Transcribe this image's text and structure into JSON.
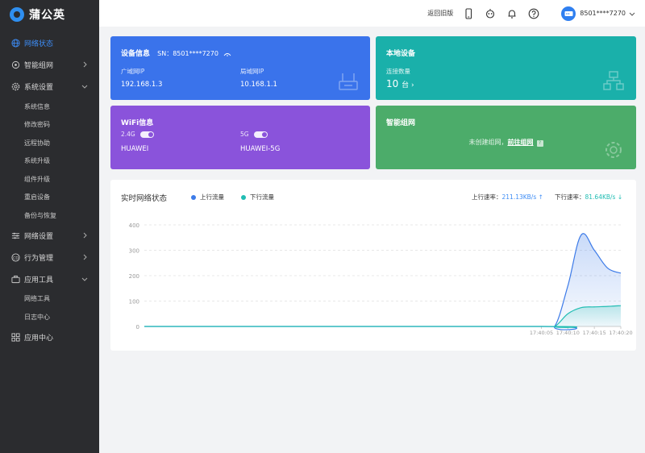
{
  "app": {
    "name": "蒲公英"
  },
  "sidebar": {
    "items": [
      {
        "label": "网络状态",
        "icon": "globe-icon",
        "active": true
      },
      {
        "label": "智能组网",
        "icon": "mesh-icon"
      },
      {
        "label": "系统设置",
        "icon": "gear-icon",
        "expanded": true,
        "children": [
          "系统信息",
          "修改密码",
          "远程协助",
          "系统升级",
          "组件升级",
          "重启设备",
          "备份与恢复"
        ]
      },
      {
        "label": "网络设置",
        "icon": "sliders-icon"
      },
      {
        "label": "行为管理",
        "icon": "behavior-icon"
      },
      {
        "label": "应用工具",
        "icon": "briefcase-icon",
        "expanded": true,
        "children": [
          "网络工具",
          "日志中心"
        ]
      },
      {
        "label": "应用中心",
        "icon": "apps-grid-icon"
      }
    ]
  },
  "header": {
    "back_label": "返回旧版",
    "user": "8501****7270",
    "icons": [
      "phone-icon",
      "robot-icon",
      "bell-icon",
      "help-icon"
    ]
  },
  "cards": {
    "device": {
      "title": "设备信息",
      "sn": "SN：8501****7270",
      "wan_label": "广域网IP",
      "wan_value": "192.168.1.3",
      "lan_label": "局域网IP",
      "lan_value": "10.168.1.1"
    },
    "local": {
      "title": "本地设备",
      "count_label": "连接数量",
      "count_value": "10",
      "count_unit": "台 ›"
    },
    "wifi": {
      "title": "WiFi信息",
      "band_a": "2.4G",
      "band_b": "5G",
      "ssid_a": "HUAWEI",
      "ssid_b": "HUAWEI-5G"
    },
    "mesh": {
      "title": "智能组网",
      "text": "未创建组网，",
      "link": "前往组网"
    }
  },
  "panel": {
    "title": "实时网络状态",
    "up_rate_label": "上行速率：",
    "up_rate_value": "211.13KB/s ↑",
    "down_rate_label": "下行速率：",
    "down_rate_value": "81.64KB/s ↓"
  },
  "colors": {
    "up": "#3d7be8",
    "down": "#21bdb3"
  },
  "chart_data": {
    "type": "area",
    "x_ticks": [
      "17:40:05",
      "17:40:10",
      "17:40:15",
      "17:40:20"
    ],
    "y_ticks": [
      "0",
      "100",
      "200",
      "300",
      "400"
    ],
    "ylim": [
      0,
      400
    ],
    "grid": true,
    "legend_position": "top-left",
    "series": [
      {
        "name": "上行流量",
        "color": "#3d7be8",
        "points": [
          [
            0,
            0
          ],
          [
            30,
            0
          ],
          [
            31,
            0
          ],
          [
            32,
            160
          ],
          [
            33,
            360
          ],
          [
            34,
            300
          ],
          [
            35,
            230
          ],
          [
            36,
            210
          ]
        ]
      },
      {
        "name": "下行流量",
        "color": "#21bdb3",
        "points": [
          [
            0,
            0
          ],
          [
            30,
            0
          ],
          [
            31,
            0
          ],
          [
            32,
            50
          ],
          [
            33,
            74
          ],
          [
            34,
            77
          ],
          [
            35,
            79
          ],
          [
            36,
            82
          ]
        ]
      }
    ]
  }
}
